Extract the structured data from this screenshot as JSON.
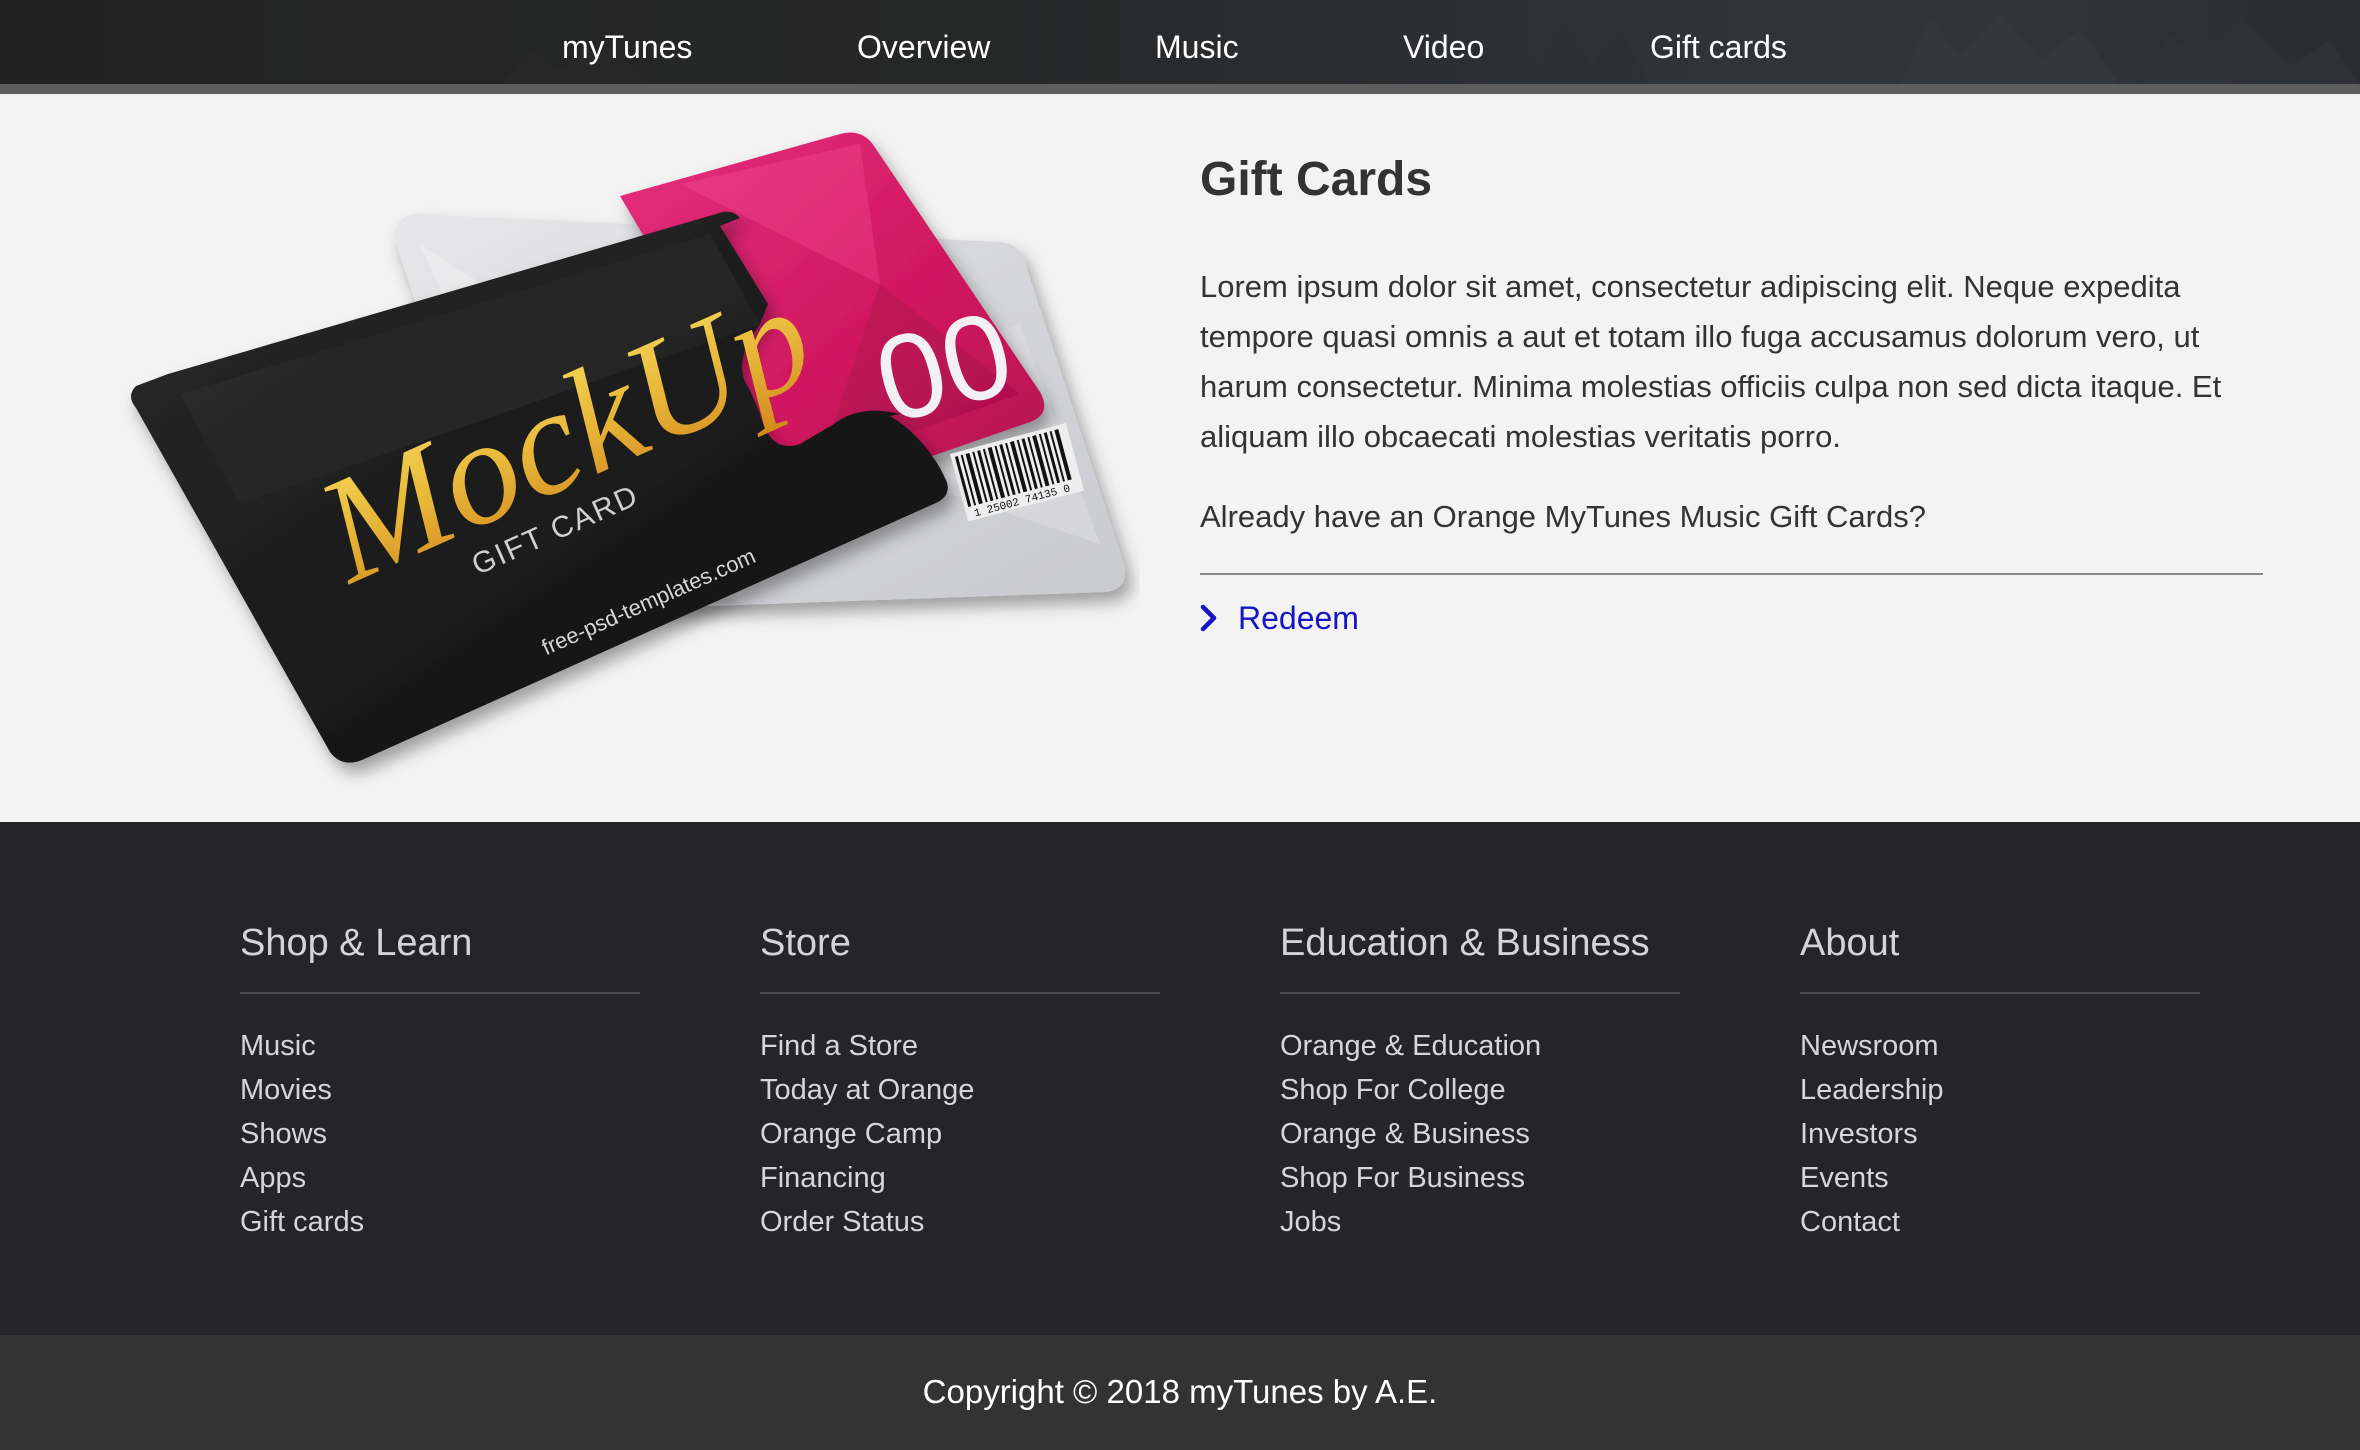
{
  "nav": {
    "items": [
      {
        "label": "myTunes"
      },
      {
        "label": "Overview"
      },
      {
        "label": "Music"
      },
      {
        "label": "Video"
      },
      {
        "label": "Gift cards"
      }
    ]
  },
  "hero": {
    "image": {
      "front_card_text": "MockUp",
      "front_card_subtext": "GIFT CARD",
      "front_card_site": "free-psd-templates.com",
      "back_card_number_fragment": "00",
      "barcode_number": "1 25002 74135 0"
    },
    "title": "Gift Cards",
    "paragraph": "Lorem ipsum dolor sit amet, consectetur adipiscing elit. Neque expedita tempore quasi omnis a aut et totam illo fuga accusamus dolorum vero, ut harum consectetur. Minima molestias officiis culpa non sed dicta itaque. Et aliquam illo obcaecati molestias veritatis porro.",
    "question": "Already have an Orange MyTunes Music Gift Cards?",
    "redeem_label": "Redeem"
  },
  "footer": {
    "columns": [
      {
        "title": "Shop & Learn",
        "links": [
          "Music",
          "Movies",
          "Shows",
          "Apps",
          "Gift cards"
        ]
      },
      {
        "title": "Store",
        "links": [
          "Find a Store",
          "Today at Orange",
          "Orange Camp",
          "Financing",
          "Order Status"
        ]
      },
      {
        "title": "Education & Business",
        "links": [
          "Orange & Education",
          "Shop For College",
          "Orange & Business",
          "Shop For Business",
          "Jobs"
        ]
      },
      {
        "title": "About",
        "links": [
          "Newsroom",
          "Leadership",
          "Investors",
          "Events",
          "Contact"
        ]
      }
    ],
    "copyright": "Copyright © 2018 myTunes by A.E."
  },
  "colors": {
    "nav_bg": "#232323",
    "main_bg": "#f3f3f3",
    "footer_bg": "#242429",
    "copyright_bg": "#333333",
    "link_accent": "#1515c6",
    "card_pink": "#d81b6a",
    "card_gold": "#e8b83a"
  },
  "icons": {
    "redeem": "chevron-right-icon"
  }
}
